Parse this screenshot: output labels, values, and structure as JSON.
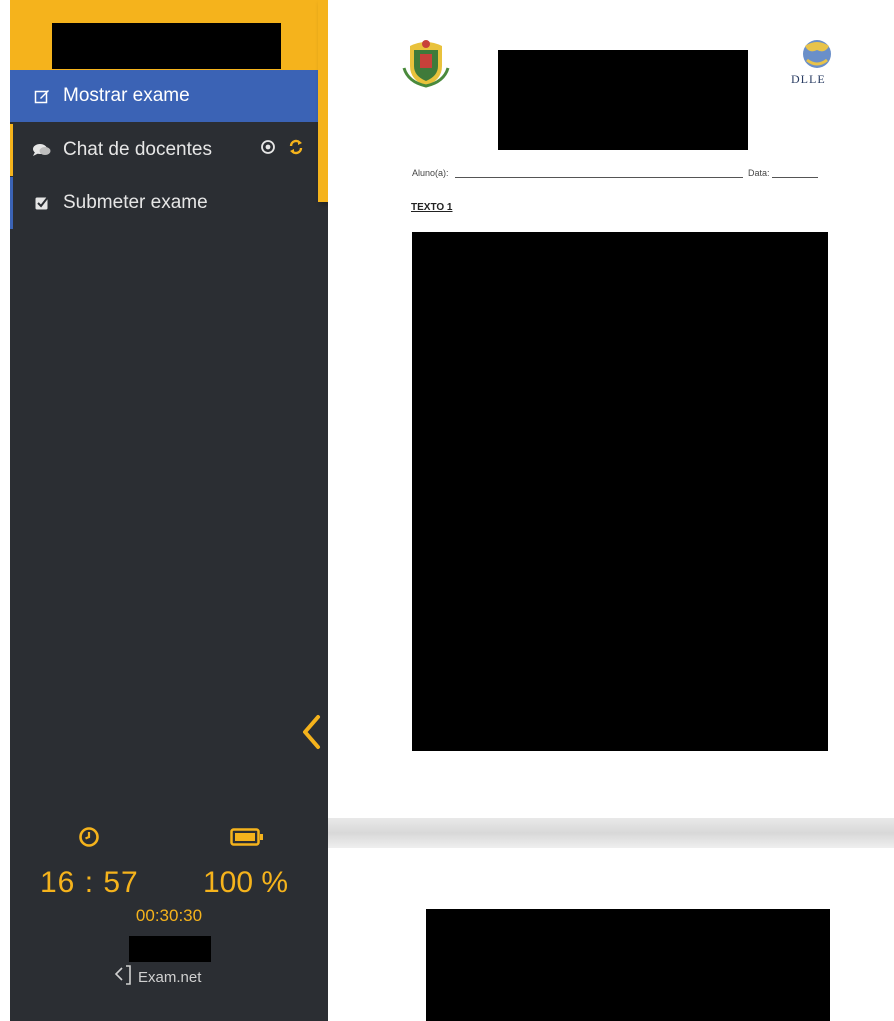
{
  "sidebar": {
    "menu": [
      {
        "label": "Mostrar exame",
        "icon": "edit-icon",
        "active": true
      },
      {
        "label": "Chat de docentes",
        "icon": "chat-icon",
        "active": false
      },
      {
        "label": "Submeter exame",
        "icon": "checkbox-icon",
        "active": false
      }
    ],
    "status": {
      "clock_time": "16 : 57",
      "battery": "100 %",
      "elapsed": "00:30:30"
    },
    "brand": "Exam.net"
  },
  "toolbar": {
    "buttons": [
      "zoom-in-icon",
      "zoom-out-icon",
      "single-page-view-icon",
      "two-page-view-icon"
    ]
  },
  "document": {
    "logo_text": "DLLE",
    "student_label": "Aluno(a):",
    "date_label": "Data:",
    "section_title": "TEXTO 1"
  },
  "colors": {
    "accent": "#f5b31c",
    "sidebar_bg": "#2b2e33",
    "active_item": "#3b63b5"
  }
}
